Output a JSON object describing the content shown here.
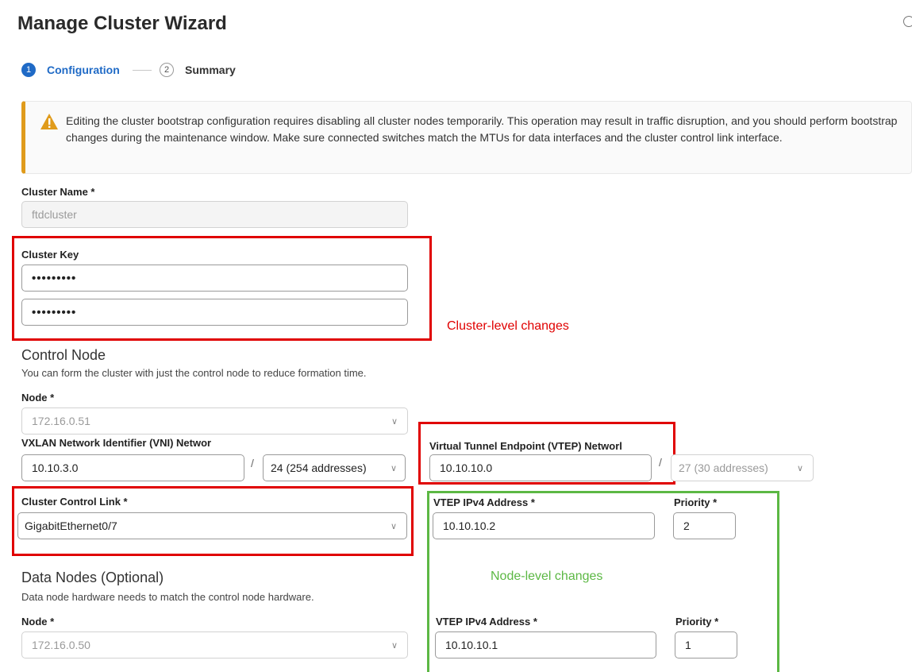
{
  "wizard": {
    "title": "Manage Cluster Wizard"
  },
  "steps": [
    {
      "number": "1",
      "label": "Configuration"
    },
    {
      "number": "2",
      "label": "Summary"
    }
  ],
  "warning": {
    "text": "Editing the cluster bootstrap configuration requires disabling all cluster nodes temporarily. This operation may result in traffic disruption, and you should perform bootstrap changes during the maintenance window. Make sure connected switches match the MTUs for data interfaces and the cluster control link interface."
  },
  "cluster_name": {
    "label": "Cluster Name *",
    "value": "ftdcluster"
  },
  "cluster_key": {
    "label": "Cluster Key",
    "value1": "•••••••••",
    "value2": "•••••••••"
  },
  "annotations": {
    "cluster_level": "Cluster-level changes",
    "node_level": "Node-level changes"
  },
  "control_node": {
    "heading": "Control Node",
    "description": "You can form the cluster with just the control node to reduce formation time.",
    "node_label": "Node *",
    "node_value": "172.16.0.51",
    "vni_label": "VXLAN Network Identifier (VNI) Networ",
    "vni_value": "10.10.3.0",
    "vni_mask": "24 (254 addresses)",
    "vtep_label": "Virtual Tunnel Endpoint (VTEP) Networl",
    "vtep_value": "10.10.10.0",
    "vtep_mask": "27 (30 addresses)",
    "ccl_label": "Cluster Control Link *",
    "ccl_value": "GigabitEthernet0/7",
    "vtep_ip_label": "VTEP IPv4 Address *",
    "vtep_ip_value": "10.10.10.2",
    "priority_label": "Priority *",
    "priority_value": "2",
    "slash": "/"
  },
  "data_nodes": {
    "heading": "Data Nodes (Optional)",
    "description": "Data node hardware needs to match the control node hardware.",
    "node_label": "Node *",
    "node_value": "172.16.0.50",
    "vtep_ip_label": "VTEP IPv4 Address *",
    "vtep_ip_value": "10.10.10.1",
    "priority_label": "Priority *",
    "priority_value": "1"
  },
  "icons": {
    "warning": "warning-triangle-icon",
    "chevron": "chevron-down-icon",
    "help": "help-circle-icon"
  },
  "colors": {
    "accent": "#1f6ac6",
    "warning": "#e09b1b",
    "annotation_red": "#e00000",
    "annotation_green": "#5cb844"
  }
}
